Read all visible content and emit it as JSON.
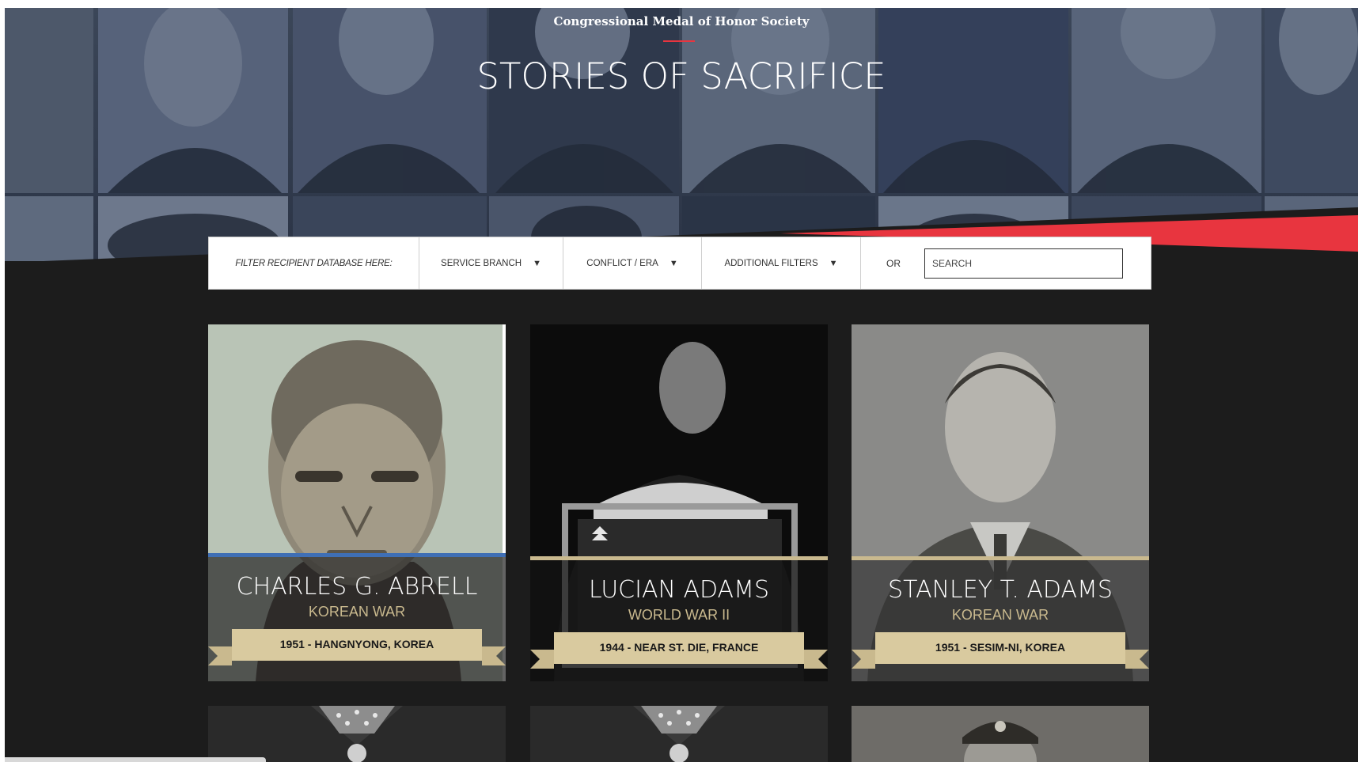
{
  "hero": {
    "site_title": "Congressional Medal of Honor Society",
    "heading": "STORIES OF SACRIFICE"
  },
  "filters": {
    "label": "FILTER RECIPIENT DATABASE HERE:",
    "service_branch": "SERVICE BRANCH",
    "conflict_era": "CONFLICT / ERA",
    "additional_filters": "ADDITIONAL FILTERS",
    "or_label": "OR",
    "search_placeholder": "SEARCH",
    "search_value": ""
  },
  "recipients": [
    {
      "name": "CHARLES G. ABRELL",
      "conflict": "KOREAN WAR",
      "action": "1951 - HANGNYONG, KOREA",
      "stripe_color": "#3f6fb5"
    },
    {
      "name": "LUCIAN ADAMS",
      "conflict": "WORLD WAR II",
      "action": "1944 - NEAR ST. DIE, FRANCE",
      "stripe_color": "#c9b98e"
    },
    {
      "name": "STANLEY T. ADAMS",
      "conflict": "KOREAN WAR",
      "action": "1951 - SESIM-NI, KOREA",
      "stripe_color": "#c9b98e"
    }
  ],
  "colors": {
    "accent_red": "#e8353f",
    "gold": "#c9b98e",
    "background": "#1c1c1c",
    "hero_overlay": "#2a3547"
  },
  "icons": {
    "dropdown": "triangle-down-icon"
  }
}
